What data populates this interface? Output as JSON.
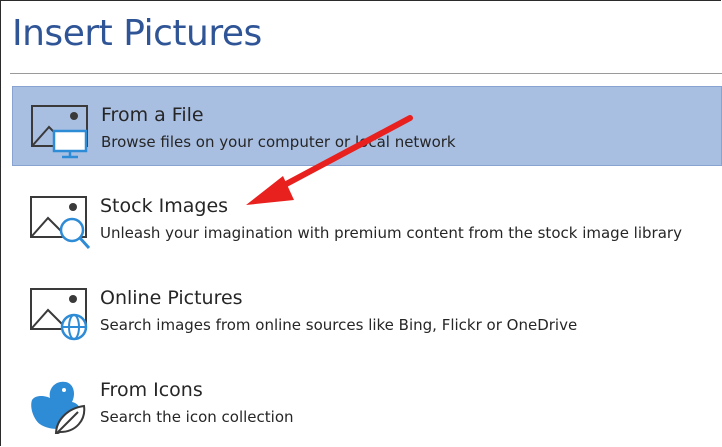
{
  "dialog": {
    "title": "Insert Pictures"
  },
  "options": [
    {
      "title": "From a File",
      "description": "Browse files on your computer or local network"
    },
    {
      "title": "Stock Images",
      "description": "Unleash your imagination with premium content from the stock image library"
    },
    {
      "title": "Online Pictures",
      "description": "Search images from online sources like Bing, Flickr or OneDrive"
    },
    {
      "title": "From Icons",
      "description": "Search the icon collection"
    }
  ],
  "colors": {
    "title": "#2f5597",
    "selected_background": "#a8bfe2",
    "icon_blue": "#2e8bd6",
    "annotation_arrow": "#e8201e"
  }
}
